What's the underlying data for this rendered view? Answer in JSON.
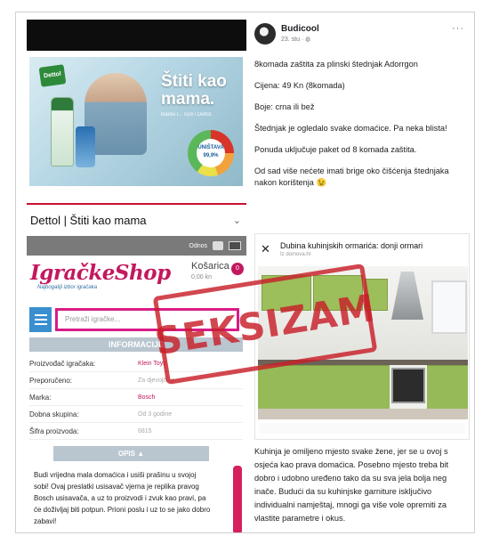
{
  "left": {
    "ad": {
      "logo": "Dettol",
      "headline_line1": "Štiti kao",
      "headline_line2": "mama.",
      "subline": "Baktiv i... rodi i Dettol.",
      "gauge_label": "UNIŠTAVA 99,9%",
      "caption": "Dettol | Štiti kao mama",
      "caption_icon": "chevron-down-icon"
    },
    "shop": {
      "top_links": "Odnos",
      "brand": "IgračkeShop",
      "tagline": "Najbogatiji izbor igračaka",
      "cart_label": "Košarica",
      "cart_sub": "0,00 kn",
      "cart_count": "0",
      "search_placeholder": "Pretraži igračke...",
      "info_header": "INFORMACIJE",
      "specs": [
        {
          "key": "Proizvođač igračaka:",
          "value": "Klein Toys"
        },
        {
          "key": "Preporučeno:",
          "value": "Za djevojčice"
        },
        {
          "key": "Marka:",
          "value": "Bosch"
        },
        {
          "key": "Dobna skupina:",
          "value": "Od 3 godine"
        },
        {
          "key": "Šifra proizvoda:",
          "value": "6815"
        }
      ],
      "opis_header": "OPIS ▲",
      "description": "Budi vrijedna mala domaćica i usiši prašinu u svojoj sobi! Ovaj preslatki usisavač vjerna je replika pravog Bosch usisavača, a uz to proizvodi i zvuk kao pravi, pa će doživljaj biti potpun. Prioni poslu i uz to se jako dobro zabavi!"
    },
    "stamp": "SEKSIZAM"
  },
  "right": {
    "post": {
      "author": "Budicool",
      "meta": "23. stu · ◍",
      "more": "···",
      "paragraphs": [
        "8komada zaštita za plinski štednjak Adorrgon",
        "Cijena: 49 Kn (8komada)",
        "Boje: crna ili bež",
        "Štednjak je ogledalo svake domaćice. Pa neka blista!",
        "Ponuda uključuje paket od 8 komada zaštita.",
        "Od sad više nećete imati brige oko čišćenja štednjaka nakon korištenja 😉"
      ]
    },
    "ad_card": {
      "close": "✕",
      "title": "Dubina kuhinjskih ormarića: donji ormari",
      "subtitle": "Iz domova.hr"
    },
    "article": "Kuhinja je omiljeno mjesto svake žene, jer se u ovoj s osjeća kao prava domaćica. Posebno mjesto treba bit dobro i udobno uređeno tako da su sva jela bolja neg inače. Budući da su kuhinjske garniture isključivo individualni namještaj, mnogi ga više vole opremiti za vlastite parametre i okus."
  },
  "colors": {
    "stamp_red": "#c81e28",
    "brand_pink": "#c3185f",
    "search_border": "#d91b86",
    "hamburger_blue": "#3a8fd0",
    "cabinet_green": "#9cbf5b"
  }
}
